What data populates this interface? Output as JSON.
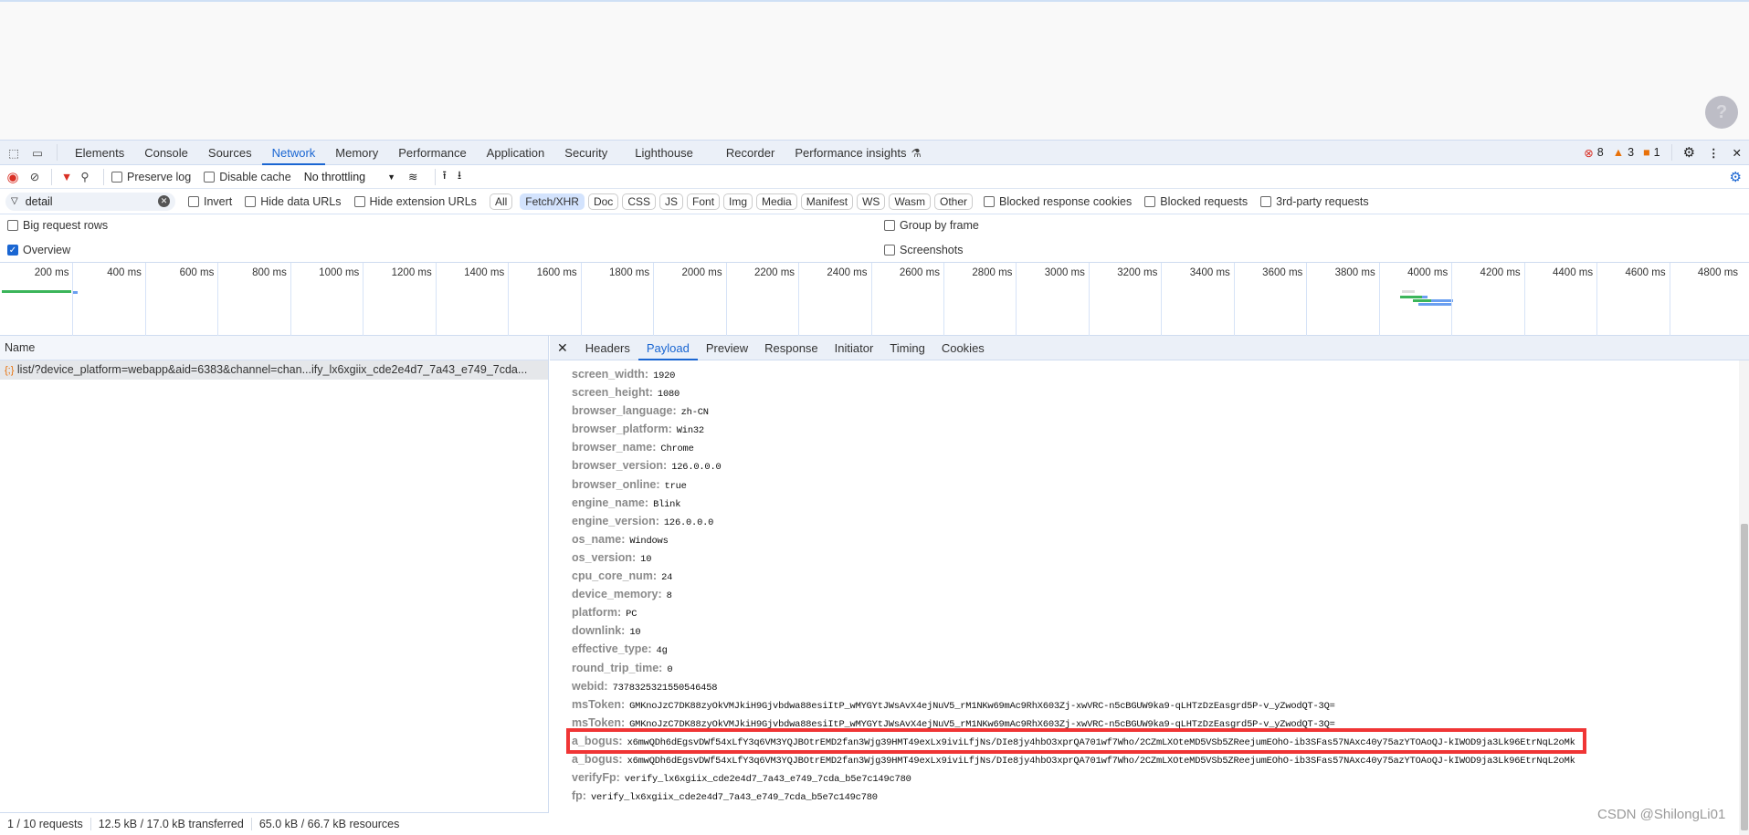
{
  "page": {
    "help_icon": "question-circle-icon"
  },
  "devtools": {
    "tabs": [
      "Elements",
      "Console",
      "Sources",
      "Network",
      "Memory",
      "Performance",
      "Application",
      "Security",
      "Lighthouse",
      "Recorder",
      "Performance insights"
    ],
    "active_tab": "Network",
    "errors": "8",
    "warnings": "3",
    "issues": "1"
  },
  "toolbar": {
    "preserve_log": "Preserve log",
    "disable_cache": "Disable cache",
    "throttling": "No throttling"
  },
  "filter": {
    "value": "detail",
    "invert": "Invert",
    "hide_data_urls": "Hide data URLs",
    "hide_extension_urls": "Hide extension URLs",
    "types": [
      "All",
      "Fetch/XHR",
      "Doc",
      "CSS",
      "JS",
      "Font",
      "Img",
      "Media",
      "Manifest",
      "WS",
      "Wasm",
      "Other"
    ],
    "active_type": "Fetch/XHR",
    "blocked_cookies": "Blocked response cookies",
    "blocked_requests": "Blocked requests",
    "third_party": "3rd-party requests"
  },
  "options": {
    "big_rows": "Big request rows",
    "overview": "Overview",
    "group_by_frame": "Group by frame",
    "screenshots": "Screenshots",
    "overview_checked": true
  },
  "timeline": {
    "ticks": [
      "200 ms",
      "400 ms",
      "600 ms",
      "800 ms",
      "1000 ms",
      "1200 ms",
      "1400 ms",
      "1600 ms",
      "1800 ms",
      "2000 ms",
      "2200 ms",
      "2400 ms",
      "2600 ms",
      "2800 ms",
      "3000 ms",
      "3200 ms",
      "3400 ms",
      "3600 ms",
      "3800 ms",
      "4000 ms",
      "4200 ms",
      "4400 ms",
      "4600 ms",
      "4800 ms"
    ]
  },
  "requests": {
    "name_header": "Name",
    "rows": [
      {
        "name": "list/?device_platform=webapp&aid=6383&channel=chan...ify_lx6xgiix_cde2e4d7_7a43_e749_7cda..."
      }
    ]
  },
  "detail": {
    "tabs": [
      "Headers",
      "Payload",
      "Preview",
      "Response",
      "Initiator",
      "Timing",
      "Cookies"
    ],
    "active_tab": "Payload",
    "payload": [
      {
        "k": "screen_width:",
        "v": "1920"
      },
      {
        "k": "screen_height:",
        "v": "1080"
      },
      {
        "k": "browser_language:",
        "v": "zh-CN"
      },
      {
        "k": "browser_platform:",
        "v": "Win32"
      },
      {
        "k": "browser_name:",
        "v": "Chrome"
      },
      {
        "k": "browser_version:",
        "v": "126.0.0.0"
      },
      {
        "k": "browser_online:",
        "v": "true"
      },
      {
        "k": "engine_name:",
        "v": "Blink"
      },
      {
        "k": "engine_version:",
        "v": "126.0.0.0"
      },
      {
        "k": "os_name:",
        "v": "Windows"
      },
      {
        "k": "os_version:",
        "v": "10"
      },
      {
        "k": "cpu_core_num:",
        "v": "24"
      },
      {
        "k": "device_memory:",
        "v": "8"
      },
      {
        "k": "platform:",
        "v": "PC"
      },
      {
        "k": "downlink:",
        "v": "10"
      },
      {
        "k": "effective_type:",
        "v": "4g"
      },
      {
        "k": "round_trip_time:",
        "v": "0"
      },
      {
        "k": "webid:",
        "v": "7378325321550546458"
      },
      {
        "k": "msToken:",
        "v": "GMKnoJzC7DK88zyOkVMJkiH9Gjvbdwa88esiItP_wMYGYtJWsAvX4ejNuV5_rM1NKw69mAc9RhX603Zj-xwVRC-n5cBGUW9ka9-qLHTzDzEasgrd5P-v_yZwodQT-3Q="
      },
      {
        "k": "msToken:",
        "v": "GMKnoJzC7DK88zyOkVMJkiH9Gjvbdwa88esiItP_wMYGYtJWsAvX4ejNuV5_rM1NKw69mAc9RhX603Zj-xwVRC-n5cBGUW9ka9-qLHTzDzEasgrd5P-v_yZwodQT-3Q="
      },
      {
        "k": "a_bogus:",
        "v": "x6mwQDh6dEgsvDWf54xLfY3q6VM3YQJBOtrEMD2fan3Wjg39HMT49exLx9iviLfjNs/DIe8jy4hbO3xprQA701wf7Who/2CZmLXOteMD5VSb5ZReejumEOhO-ib3SFas57NAxc40y75azYTOAoQJ-kIWOD9ja3Lk96EtrNqL2oMk",
        "highlighted": true
      },
      {
        "k": "a_bogus:",
        "v": "x6mwQDh6dEgsvDWf54xLfY3q6VM3YQJBOtrEMD2fan3Wjg39HMT49exLx9iviLfjNs/DIe8jy4hbO3xprQA701wf7Who/2CZmLXOteMD5VSb5ZReejumEOhO-ib3SFas57NAxc40y75azYTOAoQJ-kIWOD9ja3Lk96EtrNqL2oMk"
      },
      {
        "k": "verifyFp:",
        "v": "verify_lx6xgiix_cde2e4d7_7a43_e749_7cda_b5e7c149c780"
      },
      {
        "k": "fp:",
        "v": "verify_lx6xgiix_cde2e4d7_7a43_e749_7cda_b5e7c149c780"
      }
    ]
  },
  "status": {
    "requests": "1 / 10 requests",
    "transferred": "12.5 kB / 17.0 kB transferred",
    "resources": "65.0 kB / 66.7 kB resources"
  },
  "watermark": "CSDN @ShilongLi01",
  "colors": {
    "accent": "#1a66d2",
    "highlight_box": "#f03535",
    "error": "#d93025",
    "warning": "#e8710a"
  }
}
